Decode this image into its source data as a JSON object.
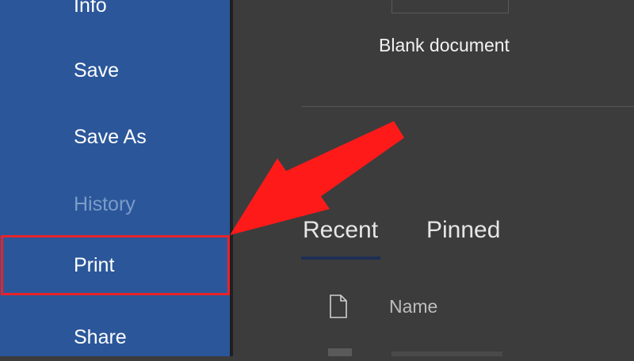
{
  "nav": {
    "items": [
      {
        "label": "Info",
        "enabled": true
      },
      {
        "label": "Save",
        "enabled": true
      },
      {
        "label": "Save As",
        "enabled": true
      },
      {
        "label": "History",
        "enabled": false
      },
      {
        "label": "Print",
        "enabled": true
      },
      {
        "label": "Share",
        "enabled": true
      }
    ]
  },
  "main": {
    "new_doc": {
      "label": "Blank document"
    },
    "tabs": [
      {
        "label": "Recent",
        "active": true
      },
      {
        "label": "Pinned",
        "active": false
      }
    ],
    "list": {
      "column_name": "Name",
      "column_icon": "document-icon"
    }
  },
  "colors": {
    "nav_bg": "#2b579a",
    "highlight": "#e8232a",
    "arrow": "#ff1a1a",
    "content_bg": "#3c3c3c"
  },
  "annotation": {
    "icon": "red-arrow-icon",
    "target": "Print"
  }
}
